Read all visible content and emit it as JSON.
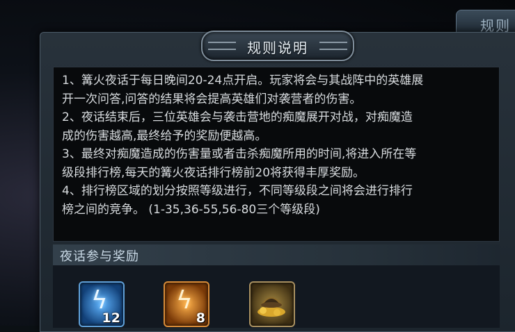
{
  "background_tab": {
    "label": "规则"
  },
  "dialog": {
    "title": "规则说明",
    "rules": [
      "1、篝火夜话于每日晚间20-24点开启。玩家将会与其战阵中的英雄展",
      "开一次问答,问答的结果将会提高英雄们对袭营者的伤害。",
      "2、夜话结束后，三位英雄会与袭击营地的痴魔展开对战，对痴魔造",
      "成的伤害越高,最终给予的奖励便越高。",
      "3、最终对痴魔造成的伤害量或者击杀痴魔所用的时间,将进入所在等",
      "级段排行榜,每天的篝火夜话排行榜前20将获得丰厚奖励。",
      "4、排行榜区域的划分按照等级进行，不同等级段之间将会进行排行",
      "榜之间的竞争。  (1-35,36-55,56-80三个等级段)"
    ],
    "reward_section_title": "夜话参与奖励",
    "rewards": [
      {
        "icon": "blue-lightning-icon",
        "count": "12"
      },
      {
        "icon": "orange-lightning-icon",
        "count": "8"
      },
      {
        "icon": "gold-helmet-icon",
        "count": ""
      }
    ]
  }
}
